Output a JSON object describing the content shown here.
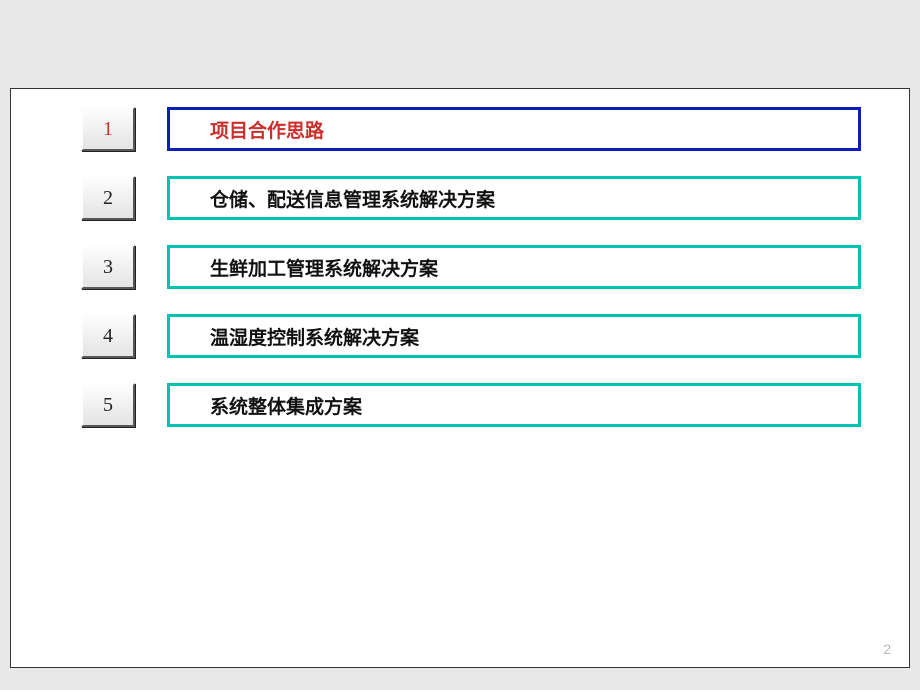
{
  "toc": {
    "items": [
      {
        "num": "1",
        "label": "项目合作思路",
        "active": true
      },
      {
        "num": "2",
        "label": "仓储、配送信息管理系统解决方案",
        "active": false
      },
      {
        "num": "3",
        "label": "生鲜加工管理系统解决方案",
        "active": false
      },
      {
        "num": "4",
        "label": "温湿度控制系统解决方案",
        "active": false
      },
      {
        "num": "5",
        "label": "系统整体集成方案",
        "active": false
      }
    ]
  },
  "page_number": "2"
}
